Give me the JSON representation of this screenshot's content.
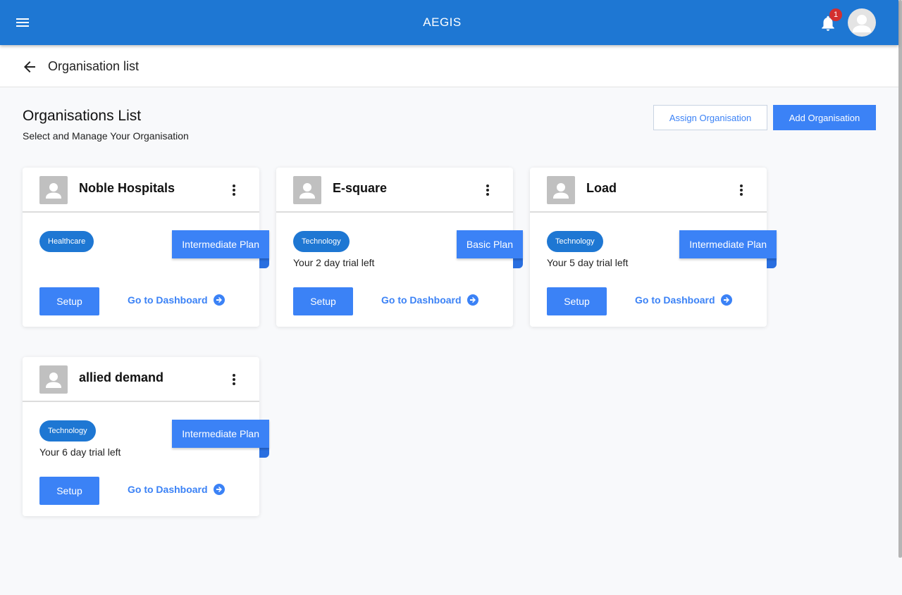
{
  "topbar": {
    "title": "AEGIS",
    "notification_count": "1"
  },
  "subheader": {
    "title": "Organisation list"
  },
  "page": {
    "title": "Organisations List",
    "subtitle": "Select and Manage Your Organisation",
    "assign_label": "Assign Organisation",
    "add_label": "Add Organisation"
  },
  "cards": [
    {
      "name": "Noble Hospitals",
      "industry": "Healthcare",
      "plan": "Intermediate Plan",
      "trial": "",
      "setup_label": "Setup",
      "dashboard_label": "Go to Dashboard"
    },
    {
      "name": "E-square",
      "industry": "Technology",
      "plan": "Basic Plan",
      "trial": "Your 2 day trial left",
      "setup_label": "Setup",
      "dashboard_label": "Go to Dashboard"
    },
    {
      "name": "Load",
      "industry": "Technology",
      "plan": "Intermediate Plan",
      "trial": "Your 5 day trial left",
      "setup_label": "Setup",
      "dashboard_label": "Go to Dashboard"
    },
    {
      "name": "allied demand",
      "industry": "Technology",
      "plan": "Intermediate Plan",
      "trial": "Your 6 day trial left",
      "setup_label": "Setup",
      "dashboard_label": "Go to Dashboard"
    }
  ],
  "colors": {
    "primary": "#1e77d3",
    "accent": "#3b82f6",
    "badge": "#d32f2f"
  },
  "icons": [
    "menu-icon",
    "bell-icon",
    "user-avatar-icon",
    "arrow-left-icon",
    "more-vert-icon",
    "arrow-circle-right-icon"
  ]
}
